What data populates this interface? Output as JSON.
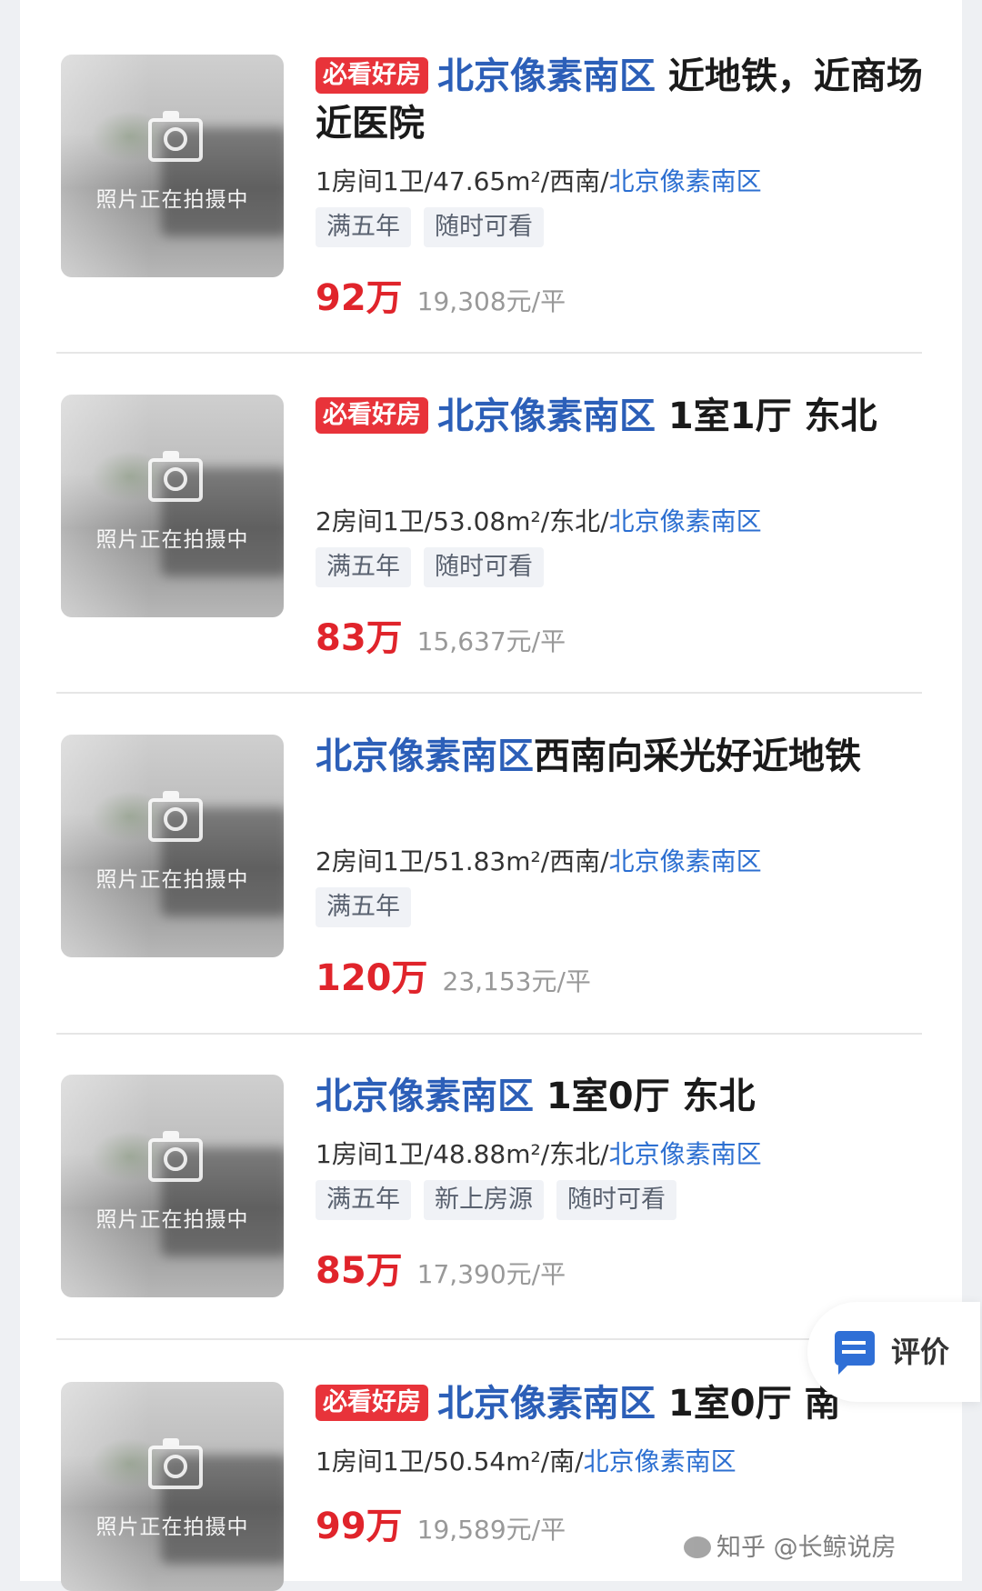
{
  "colors": {
    "accent": "#2c5fb8",
    "price": "#e0242b",
    "badge": "#e8333a"
  },
  "thumb_text": "照片正在拍摄中",
  "listings": [
    {
      "badge": "必看好房",
      "area": "北京像素南区",
      "title_rest": " 近地铁，近商场近医院",
      "spec": "1房间1卫/47.65m²/西南/",
      "spec_link": "北京像素南区",
      "tags": [
        "满五年",
        "随时可看"
      ],
      "price": "92万",
      "unit_price": "19,308元/平"
    },
    {
      "badge": "必看好房",
      "area": "北京像素南区",
      "title_rest": " 1室1厅 东北",
      "spec": "2房间1卫/53.08m²/东北/",
      "spec_link": "北京像素南区",
      "tags": [
        "满五年",
        "随时可看"
      ],
      "price": "83万",
      "unit_price": "15,637元/平"
    },
    {
      "badge": "",
      "area": "北京像素南区",
      "title_rest": "西南向采光好近地铁",
      "spec": "2房间1卫/51.83m²/西南/",
      "spec_link": "北京像素南区",
      "tags": [
        "满五年"
      ],
      "price": "120万",
      "unit_price": "23,153元/平"
    },
    {
      "badge": "",
      "area": "北京像素南区",
      "title_rest": " 1室0厅 东北",
      "spec": "1房间1卫/48.88m²/东北/",
      "spec_link": "北京像素南区",
      "tags": [
        "满五年",
        "新上房源",
        "随时可看"
      ],
      "price": "85万",
      "unit_price": "17,390元/平"
    },
    {
      "badge": "必看好房",
      "area": "北京像素南区",
      "title_rest": " 1室0厅 南",
      "spec": "1房间1卫/50.54m²/南/",
      "spec_link": "北京像素南区",
      "tags": [],
      "price": "99万",
      "unit_price": "19,589元/平"
    }
  ],
  "eval_button": {
    "label": "评价",
    "icon": "chat-icon"
  },
  "watermark": "知乎 @长鲸说房"
}
